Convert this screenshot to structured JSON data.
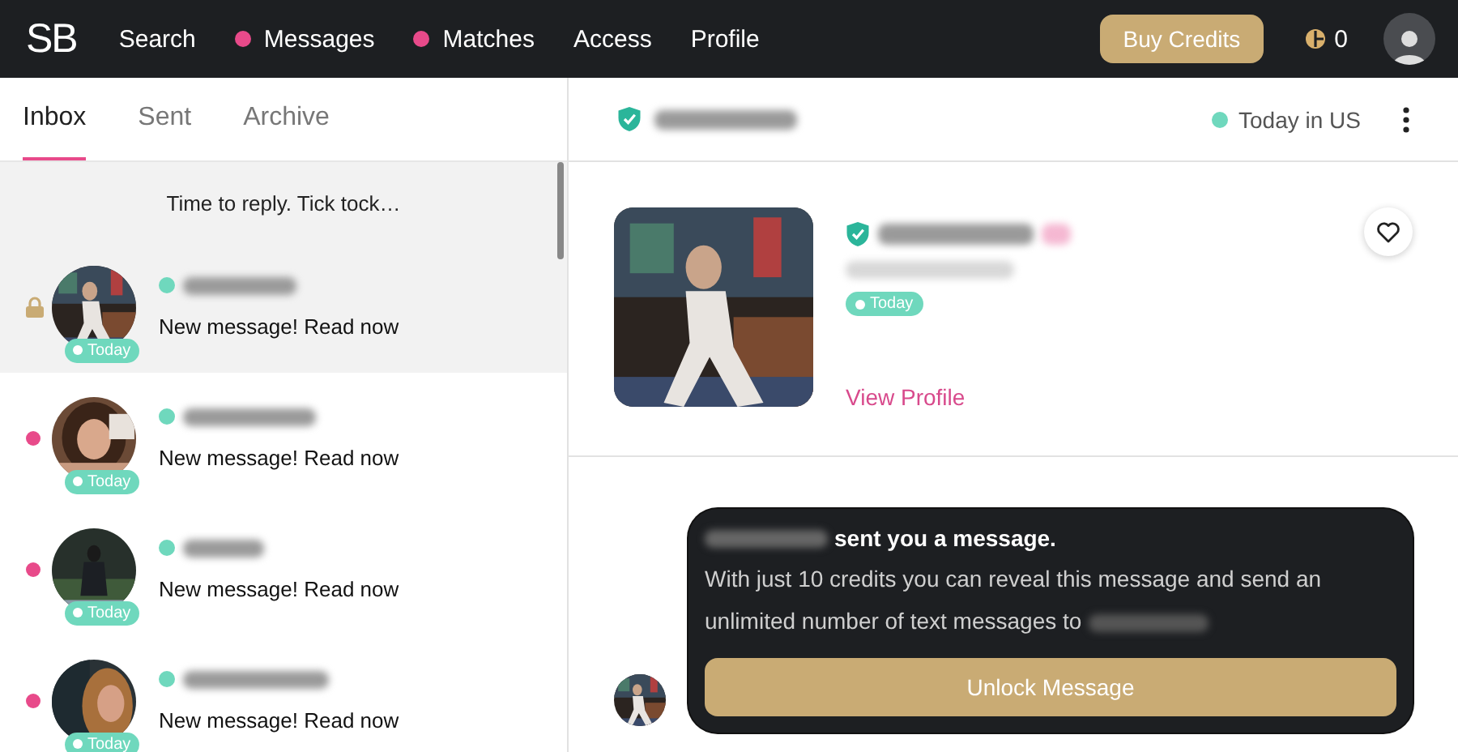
{
  "nav": {
    "logo": "SB",
    "items": [
      {
        "label": "Search",
        "notification": false
      },
      {
        "label": "Messages",
        "notification": true
      },
      {
        "label": "Matches",
        "notification": true
      },
      {
        "label": "Access",
        "notification": false
      },
      {
        "label": "Profile",
        "notification": false
      }
    ],
    "buy_button": "Buy Credits",
    "credits": "0"
  },
  "tabs": [
    {
      "label": "Inbox",
      "selected": true
    },
    {
      "label": "Sent",
      "selected": false
    },
    {
      "label": "Archive",
      "selected": false
    }
  ],
  "notice": "Time to reply. Tick tock…",
  "conversations": [
    {
      "kind": "locked",
      "selected": true,
      "online": true,
      "badge": "Today",
      "preview": "New message! Read now"
    },
    {
      "kind": "unread",
      "selected": false,
      "online": true,
      "badge": "Today",
      "preview": "New message! Read now"
    },
    {
      "kind": "unread",
      "selected": false,
      "online": true,
      "badge": "Today",
      "preview": "New message! Read now"
    },
    {
      "kind": "unread",
      "selected": false,
      "online": true,
      "badge": "Today",
      "preview": "New message! Read now"
    }
  ],
  "chat_header": {
    "verified": true,
    "last_seen": "Today in US"
  },
  "profile": {
    "verified": true,
    "badge": "Today",
    "link": "View Profile"
  },
  "message_card": {
    "headline": "sent you a message.",
    "body": "With just 10 credits you can reveal this message and send an unlimited number of text messages to",
    "button": "Unlock Message"
  }
}
